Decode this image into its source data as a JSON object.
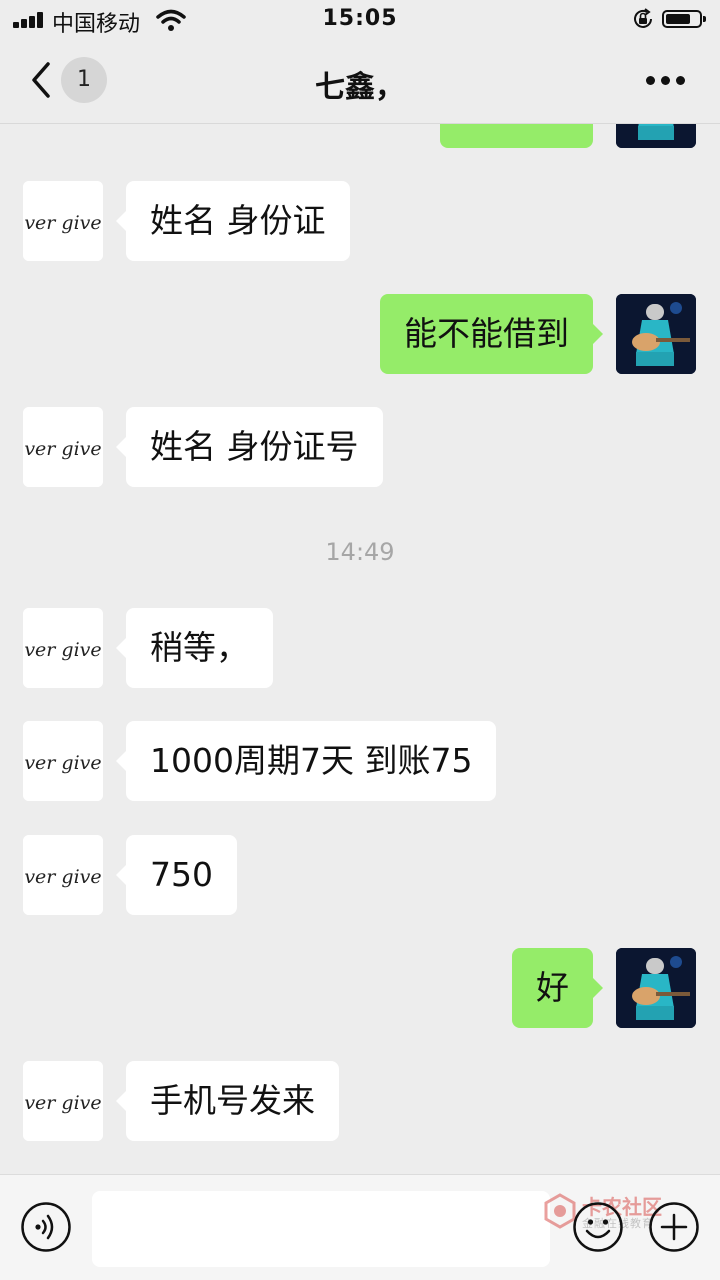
{
  "status_bar": {
    "carrier": "中国移动",
    "time": "15:05"
  },
  "navbar": {
    "unread_count": "1",
    "title": "七鑫，"
  },
  "contact_avatar_text": "ver give",
  "messages": [
    {
      "side": "left",
      "text": "姓名  身份证"
    },
    {
      "side": "right",
      "text": "能不能借到"
    },
    {
      "side": "left",
      "text": "姓名 身份证号"
    },
    {
      "side": "left",
      "text": "稍等，"
    },
    {
      "side": "left",
      "text": "1000周期7天  到账75"
    },
    {
      "side": "left",
      "text": "750"
    },
    {
      "side": "right",
      "text": "好"
    },
    {
      "side": "left",
      "text": "手机号发来"
    }
  ],
  "timestamp": "14:49",
  "watermark": {
    "title": "卡农社区",
    "subtitle": "金融在线教育"
  },
  "colors": {
    "background": "#ededed",
    "sent_bubble": "#95ec69",
    "received_bubble": "#ffffff",
    "timestamp_text": "#a6a6a6"
  }
}
